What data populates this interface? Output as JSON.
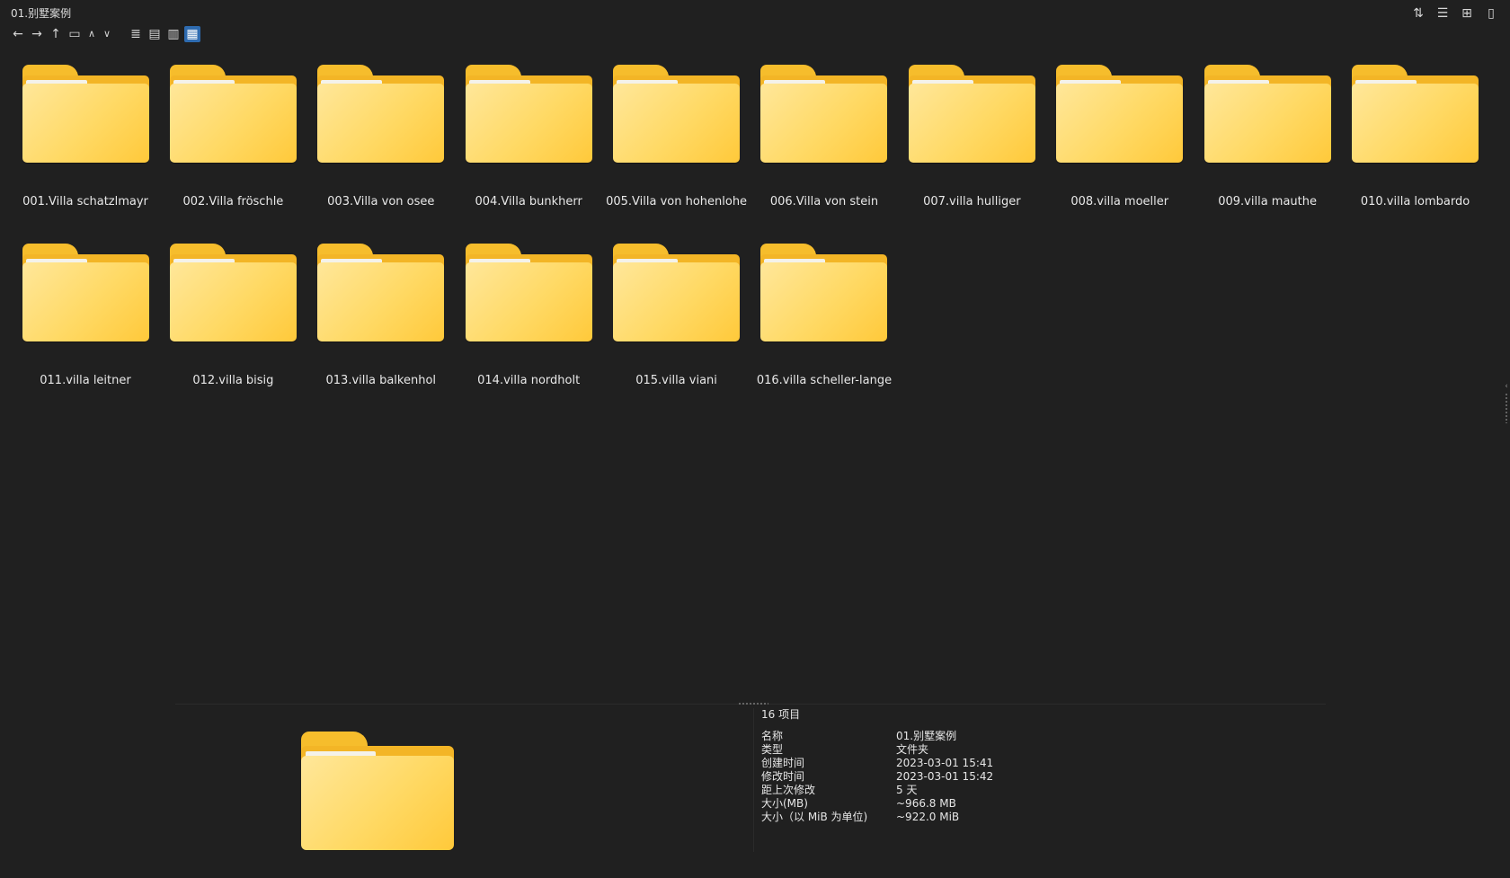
{
  "window": {
    "title": "01.别墅案例"
  },
  "toolbar": {
    "icons": [
      "back-arrow-icon",
      "forward-arrow-icon",
      "up-arrow-icon",
      "folder-icon",
      "chevron-up-icon",
      "chevron-down-icon",
      "list-view-icon",
      "details-view-icon",
      "tiles-view-icon",
      "large-icons-view-icon"
    ],
    "active_view": "large-icons"
  },
  "right_tools": {
    "icons": [
      "sort-icon",
      "group-icon",
      "new-pane-icon",
      "clipboard-icon"
    ]
  },
  "folders": [
    {
      "name": "001.Villa schatzlmayr"
    },
    {
      "name": "002.Villa fröschle"
    },
    {
      "name": "003.Villa von osee"
    },
    {
      "name": "004.Villa bunkherr"
    },
    {
      "name": "005.Villa von hohenlohe"
    },
    {
      "name": "006.Villa von stein"
    },
    {
      "name": "007.villa hulliger"
    },
    {
      "name": "008.villa moeller"
    },
    {
      "name": "009.villa mauthe"
    },
    {
      "name": "010.villa lombardo"
    },
    {
      "name": "011.villa leitner"
    },
    {
      "name": "012.villa bisig"
    },
    {
      "name": "013.villa balkenhol"
    },
    {
      "name": "014.villa nordholt"
    },
    {
      "name": "015.villa viani"
    },
    {
      "name": "016.villa scheller-lange"
    }
  ],
  "details": {
    "count": "16 项目",
    "rows": [
      {
        "key": "名称",
        "value": "01.别墅案例"
      },
      {
        "key": "类型",
        "value": "文件夹"
      },
      {
        "key": "创建时间",
        "value": "2023-03-01  15:41"
      },
      {
        "key": "修改时间",
        "value": "2023-03-01  15:42"
      },
      {
        "key": "距上次修改",
        "value": "5 天"
      },
      {
        "key": "大小(MB)",
        "value": "~966.8 MB"
      },
      {
        "key": "大小（以 MiB 为单位)",
        "value": "~922.0 MiB"
      }
    ]
  },
  "colors": {
    "background": "#202020",
    "folder_front": "#ffd964",
    "folder_back": "#f3b526",
    "active_view": "#2e6bb0"
  }
}
